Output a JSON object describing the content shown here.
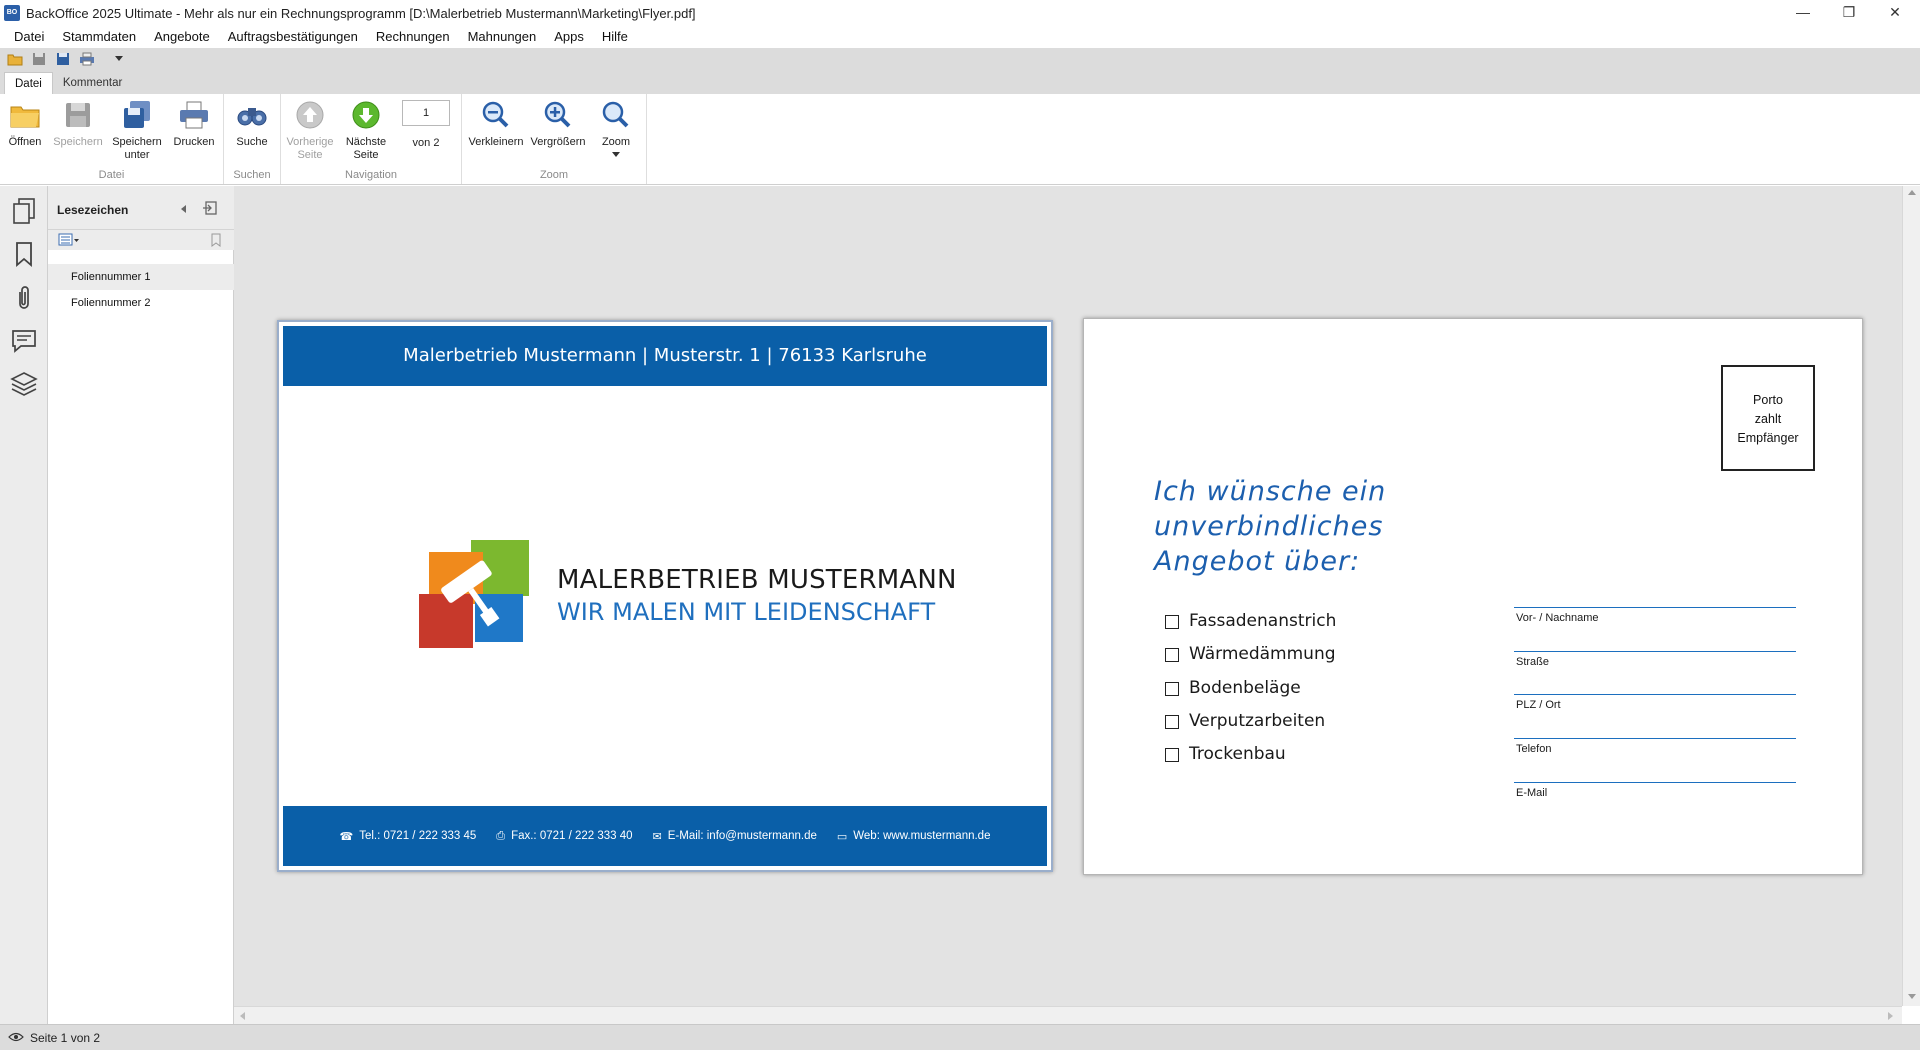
{
  "window": {
    "title": "BackOffice 2025 Ultimate - Mehr als nur ein Rechnungsprogramm [D:\\Malerbetrieb Mustermann\\Marketing\\Flyer.pdf]",
    "app_icon_text": "BO",
    "minimize": "—",
    "restore": "❐",
    "close": "✕"
  },
  "menu": [
    "Datei",
    "Stammdaten",
    "Angebote",
    "Auftragsbestätigungen",
    "Rechnungen",
    "Mahnungen",
    "Apps",
    "Hilfe"
  ],
  "ribbon": {
    "tabs": [
      "Datei",
      "Kommentar"
    ],
    "groups": {
      "datei": "Datei",
      "suchen": "Suchen",
      "navigation": "Navigation",
      "zoom": "Zoom"
    },
    "buttons": {
      "open": "Öffnen",
      "save": "Speichern",
      "save_as_1": "Speichern",
      "save_as_2": "unter",
      "print": "Drucken",
      "search": "Suche",
      "prev_1": "Vorherige",
      "prev_2": "Seite",
      "next_1": "Nächste",
      "next_2": "Seite",
      "page_of": "von 2",
      "zoom_out": "Verkleinern",
      "zoom_in": "Vergrößern",
      "zoom": "Zoom"
    },
    "page_input_value": "1"
  },
  "bookmarks": {
    "title": "Lesezeichen",
    "items": [
      "Foliennummer 1",
      "Foliennummer 2"
    ]
  },
  "page1": {
    "header": "Malerbetrieb Mustermann  |  Musterstr. 1  |  76133 Karlsruhe",
    "company_name": "MALERBETRIEB MUSTERMANN",
    "slogan": "WIR MALEN MIT LEIDENSCHAFT",
    "footer": {
      "tel": "Tel.: 0721 / 222 333 45",
      "fax": "Fax.: 0721 / 222 333 40",
      "email": "E-Mail: info@mustermann.de",
      "web": "Web: www.mustermann.de"
    }
  },
  "page2": {
    "porto_1": "Porto",
    "porto_2": "zahlt",
    "porto_3": "Empfänger",
    "hand_line_1": "Ich wünsche ein",
    "hand_line_2": "unverbindliches",
    "hand_line_3": "Angebot über:",
    "options": [
      "Fassadenanstrich",
      "Wärmedämmung",
      "Bodenbeläge",
      "Verputzarbeiten",
      "Trockenbau"
    ],
    "fields": [
      "Vor- / Nachname",
      "Straße",
      "PLZ / Ort",
      "Telefon",
      "E-Mail"
    ]
  },
  "status": {
    "text": "Seite 1 von 2"
  },
  "colors": {
    "brand_blue": "#0a5fa8",
    "handwriting_blue": "#1c5fae"
  }
}
